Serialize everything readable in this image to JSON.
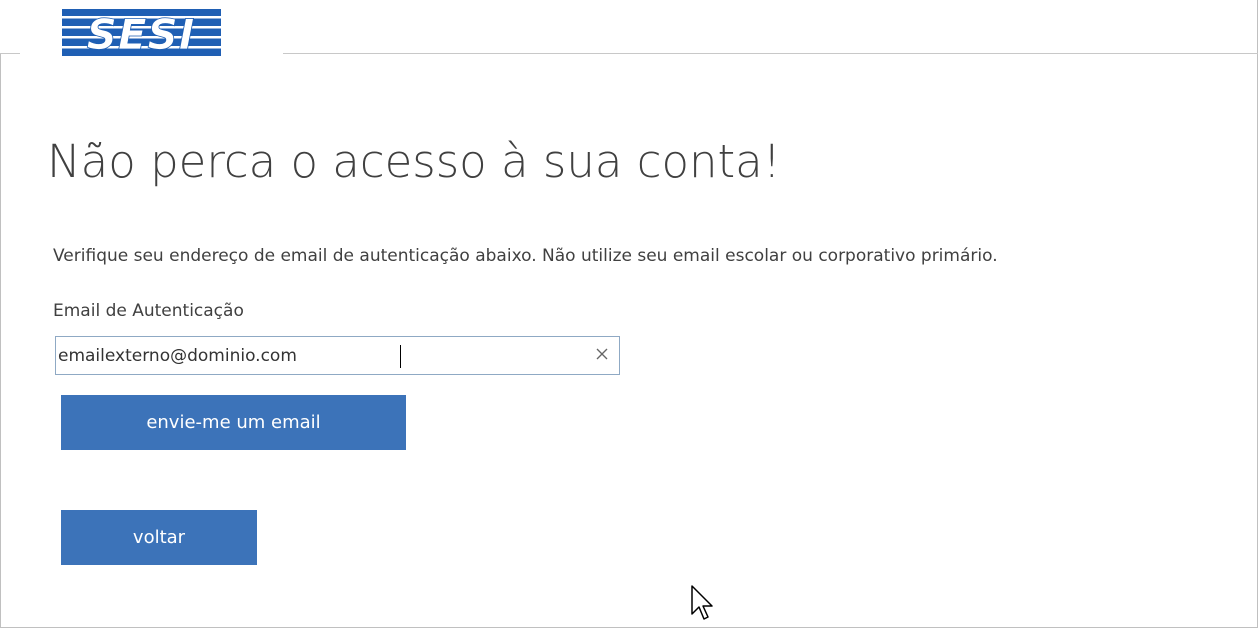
{
  "brand": {
    "logo_text": "SESI",
    "logo_color": "#1f5fb4"
  },
  "page": {
    "title": "Não perca o acesso à sua conta!",
    "description": "Verifique seu endereço de email de autenticação abaixo. Não utilize seu email escolar ou corporativo primário."
  },
  "form": {
    "email_label": "Email de Autenticação",
    "email_value": "emailexterno@dominio.com",
    "clear_icon": "close-icon"
  },
  "buttons": {
    "send_label": "envie-me um email",
    "back_label": "voltar",
    "color": "#3c73b9"
  },
  "pointer": {
    "icon": "mouse-pointer-icon"
  }
}
